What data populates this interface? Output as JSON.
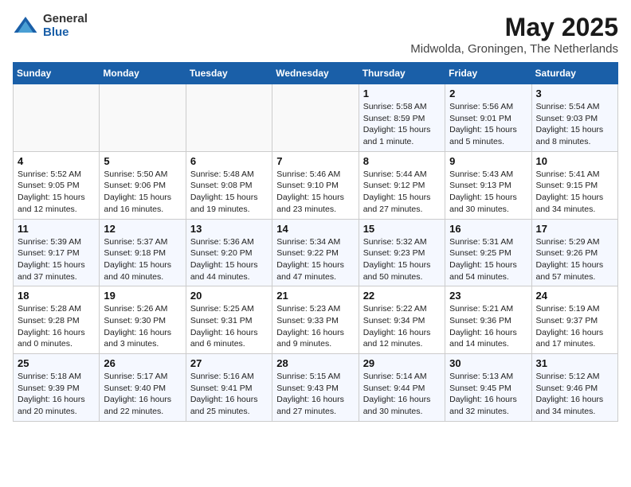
{
  "logo": {
    "general": "General",
    "blue": "Blue"
  },
  "title": "May 2025",
  "subtitle": "Midwolda, Groningen, The Netherlands",
  "days_of_week": [
    "Sunday",
    "Monday",
    "Tuesday",
    "Wednesday",
    "Thursday",
    "Friday",
    "Saturday"
  ],
  "weeks": [
    [
      {
        "day": "",
        "info": ""
      },
      {
        "day": "",
        "info": ""
      },
      {
        "day": "",
        "info": ""
      },
      {
        "day": "",
        "info": ""
      },
      {
        "day": "1",
        "info": "Sunrise: 5:58 AM\nSunset: 8:59 PM\nDaylight: 15 hours and 1 minute."
      },
      {
        "day": "2",
        "info": "Sunrise: 5:56 AM\nSunset: 9:01 PM\nDaylight: 15 hours and 5 minutes."
      },
      {
        "day": "3",
        "info": "Sunrise: 5:54 AM\nSunset: 9:03 PM\nDaylight: 15 hours and 8 minutes."
      }
    ],
    [
      {
        "day": "4",
        "info": "Sunrise: 5:52 AM\nSunset: 9:05 PM\nDaylight: 15 hours and 12 minutes."
      },
      {
        "day": "5",
        "info": "Sunrise: 5:50 AM\nSunset: 9:06 PM\nDaylight: 15 hours and 16 minutes."
      },
      {
        "day": "6",
        "info": "Sunrise: 5:48 AM\nSunset: 9:08 PM\nDaylight: 15 hours and 19 minutes."
      },
      {
        "day": "7",
        "info": "Sunrise: 5:46 AM\nSunset: 9:10 PM\nDaylight: 15 hours and 23 minutes."
      },
      {
        "day": "8",
        "info": "Sunrise: 5:44 AM\nSunset: 9:12 PM\nDaylight: 15 hours and 27 minutes."
      },
      {
        "day": "9",
        "info": "Sunrise: 5:43 AM\nSunset: 9:13 PM\nDaylight: 15 hours and 30 minutes."
      },
      {
        "day": "10",
        "info": "Sunrise: 5:41 AM\nSunset: 9:15 PM\nDaylight: 15 hours and 34 minutes."
      }
    ],
    [
      {
        "day": "11",
        "info": "Sunrise: 5:39 AM\nSunset: 9:17 PM\nDaylight: 15 hours and 37 minutes."
      },
      {
        "day": "12",
        "info": "Sunrise: 5:37 AM\nSunset: 9:18 PM\nDaylight: 15 hours and 40 minutes."
      },
      {
        "day": "13",
        "info": "Sunrise: 5:36 AM\nSunset: 9:20 PM\nDaylight: 15 hours and 44 minutes."
      },
      {
        "day": "14",
        "info": "Sunrise: 5:34 AM\nSunset: 9:22 PM\nDaylight: 15 hours and 47 minutes."
      },
      {
        "day": "15",
        "info": "Sunrise: 5:32 AM\nSunset: 9:23 PM\nDaylight: 15 hours and 50 minutes."
      },
      {
        "day": "16",
        "info": "Sunrise: 5:31 AM\nSunset: 9:25 PM\nDaylight: 15 hours and 54 minutes."
      },
      {
        "day": "17",
        "info": "Sunrise: 5:29 AM\nSunset: 9:26 PM\nDaylight: 15 hours and 57 minutes."
      }
    ],
    [
      {
        "day": "18",
        "info": "Sunrise: 5:28 AM\nSunset: 9:28 PM\nDaylight: 16 hours and 0 minutes."
      },
      {
        "day": "19",
        "info": "Sunrise: 5:26 AM\nSunset: 9:30 PM\nDaylight: 16 hours and 3 minutes."
      },
      {
        "day": "20",
        "info": "Sunrise: 5:25 AM\nSunset: 9:31 PM\nDaylight: 16 hours and 6 minutes."
      },
      {
        "day": "21",
        "info": "Sunrise: 5:23 AM\nSunset: 9:33 PM\nDaylight: 16 hours and 9 minutes."
      },
      {
        "day": "22",
        "info": "Sunrise: 5:22 AM\nSunset: 9:34 PM\nDaylight: 16 hours and 12 minutes."
      },
      {
        "day": "23",
        "info": "Sunrise: 5:21 AM\nSunset: 9:36 PM\nDaylight: 16 hours and 14 minutes."
      },
      {
        "day": "24",
        "info": "Sunrise: 5:19 AM\nSunset: 9:37 PM\nDaylight: 16 hours and 17 minutes."
      }
    ],
    [
      {
        "day": "25",
        "info": "Sunrise: 5:18 AM\nSunset: 9:39 PM\nDaylight: 16 hours and 20 minutes."
      },
      {
        "day": "26",
        "info": "Sunrise: 5:17 AM\nSunset: 9:40 PM\nDaylight: 16 hours and 22 minutes."
      },
      {
        "day": "27",
        "info": "Sunrise: 5:16 AM\nSunset: 9:41 PM\nDaylight: 16 hours and 25 minutes."
      },
      {
        "day": "28",
        "info": "Sunrise: 5:15 AM\nSunset: 9:43 PM\nDaylight: 16 hours and 27 minutes."
      },
      {
        "day": "29",
        "info": "Sunrise: 5:14 AM\nSunset: 9:44 PM\nDaylight: 16 hours and 30 minutes."
      },
      {
        "day": "30",
        "info": "Sunrise: 5:13 AM\nSunset: 9:45 PM\nDaylight: 16 hours and 32 minutes."
      },
      {
        "day": "31",
        "info": "Sunrise: 5:12 AM\nSunset: 9:46 PM\nDaylight: 16 hours and 34 minutes."
      }
    ]
  ]
}
